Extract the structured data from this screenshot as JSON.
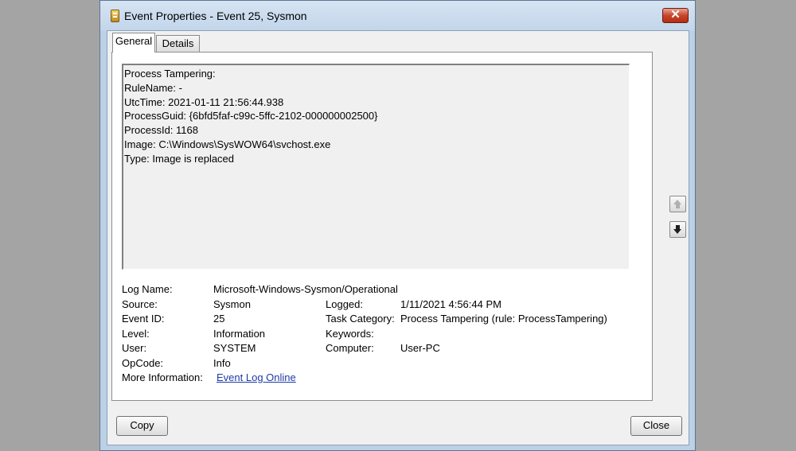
{
  "window": {
    "title": "Event Properties - Event 25, Sysmon",
    "close_glyph": "✕"
  },
  "tabs": [
    {
      "label": "General",
      "active": true
    },
    {
      "label": "Details",
      "active": false
    }
  ],
  "description": [
    "Process Tampering:",
    "RuleName: -",
    "UtcTime: 2021-01-11 21:56:44.938",
    "ProcessGuid: {6bfd5faf-c99c-5ffc-2102-000000002500}",
    "ProcessId: 1168",
    "Image: C:\\Windows\\SysWOW64\\svchost.exe",
    "Type: Image is replaced"
  ],
  "fields": {
    "log_name": {
      "label": "Log Name:",
      "value": "Microsoft-Windows-Sysmon/Operational"
    },
    "source": {
      "label": "Source:",
      "value": "Sysmon"
    },
    "logged": {
      "label": "Logged:",
      "value": "1/11/2021 4:56:44 PM"
    },
    "event_id": {
      "label": "Event ID:",
      "value": "25"
    },
    "task_category": {
      "label": "Task Category:",
      "value": "Process Tampering (rule: ProcessTampering)"
    },
    "level": {
      "label": "Level:",
      "value": "Information"
    },
    "keywords": {
      "label": "Keywords:",
      "value": ""
    },
    "user": {
      "label": "User:",
      "value": "SYSTEM"
    },
    "computer": {
      "label": "Computer:",
      "value": "User-PC"
    },
    "opcode": {
      "label": "OpCode:",
      "value": "Info"
    },
    "more_info": {
      "label": "More Information:",
      "link": "Event Log Online"
    }
  },
  "buttons": {
    "copy": "Copy",
    "close": "Close"
  },
  "icons": {
    "app": "event-viewer-icon",
    "prev": "arrow-up-icon",
    "next": "arrow-down-icon"
  },
  "colors": {
    "title_bar": "#c8d9ec",
    "close_button": "#c7452b",
    "link": "#1e3aa8"
  }
}
